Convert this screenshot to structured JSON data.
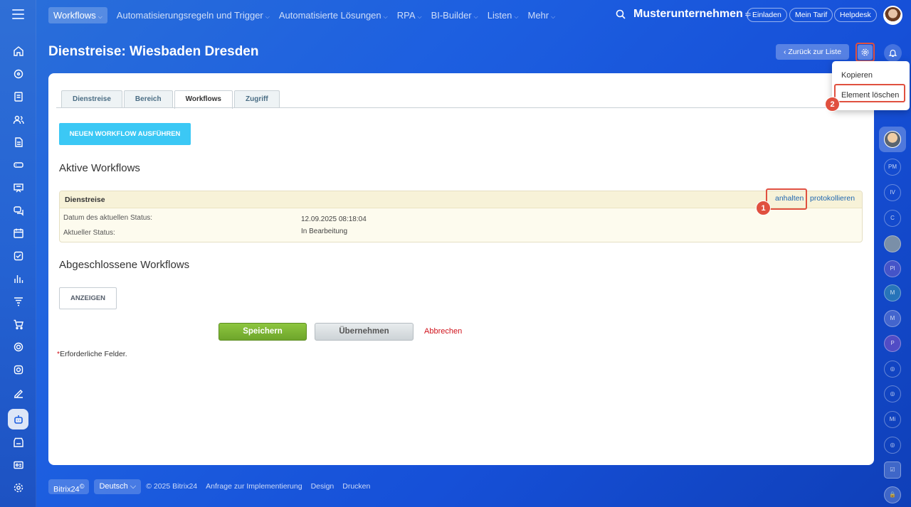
{
  "topnav": {
    "items": [
      {
        "label": "Workflows",
        "active": true
      },
      {
        "label": "Automatisierungsregeln und Trigger"
      },
      {
        "label": "Automatisierte Lösungen"
      },
      {
        "label": "RPA"
      },
      {
        "label": "BI-Builder"
      },
      {
        "label": "Listen"
      },
      {
        "label": "Mehr"
      }
    ],
    "caret": "⌵",
    "company": "Musterunternehmen",
    "company_icon": "≑",
    "invite": "Einladen",
    "my_plan": "Mein Tarif",
    "helpdesk": "Helpdesk"
  },
  "header": {
    "title": "Dienstreise: Wiesbaden Dresden",
    "back_label": "Zurück zur Liste"
  },
  "settings_menu": {
    "items": [
      "Kopieren",
      "Element löschen"
    ]
  },
  "tabs": [
    "Dienstreise",
    "Bereich",
    "Workflows",
    "Zugriff"
  ],
  "active_tab": "Workflows",
  "main": {
    "run_button": "NEUEN WORKFLOW AUSFÜHREN",
    "active_heading": "Aktive Workflows",
    "workflow": {
      "name": "Dienstreise",
      "stop_link": "anhalten",
      "log_link": "protokollieren",
      "status_date_label": "Datum des aktuellen Status:",
      "status_date_value": "12.09.2025 08:18:04",
      "status_label": "Aktueller Status:",
      "status_value": "In Bearbeitung"
    },
    "completed_heading": "Abgeschlossene Workflows",
    "show_button": "ANZEIGEN",
    "save_button": "Speichern",
    "apply_button": "Übernehmen",
    "cancel_link": "Abbrechen",
    "required_star": "*",
    "required_text": "Erforderliche Felder."
  },
  "markers": [
    "1",
    "2"
  ],
  "right_bar": {
    "initials": [
      "PM",
      "IV",
      "C",
      "Pl",
      "M",
      "M",
      "P",
      "Mi"
    ]
  },
  "footer": {
    "brand": "Bitrix24",
    "brand_mark": "©",
    "language": "Deutsch",
    "copyright": "© 2025 Bitrix24",
    "implementation": "Anfrage zur Implementierung",
    "design": "Design",
    "print": "Drucken"
  },
  "colors": {
    "accent_blue": "#3bc8f5",
    "save_green": "#7ab833",
    "highlight_red": "#e0503f",
    "link_blue": "#2067b0",
    "cancel_red": "#d0121b"
  }
}
